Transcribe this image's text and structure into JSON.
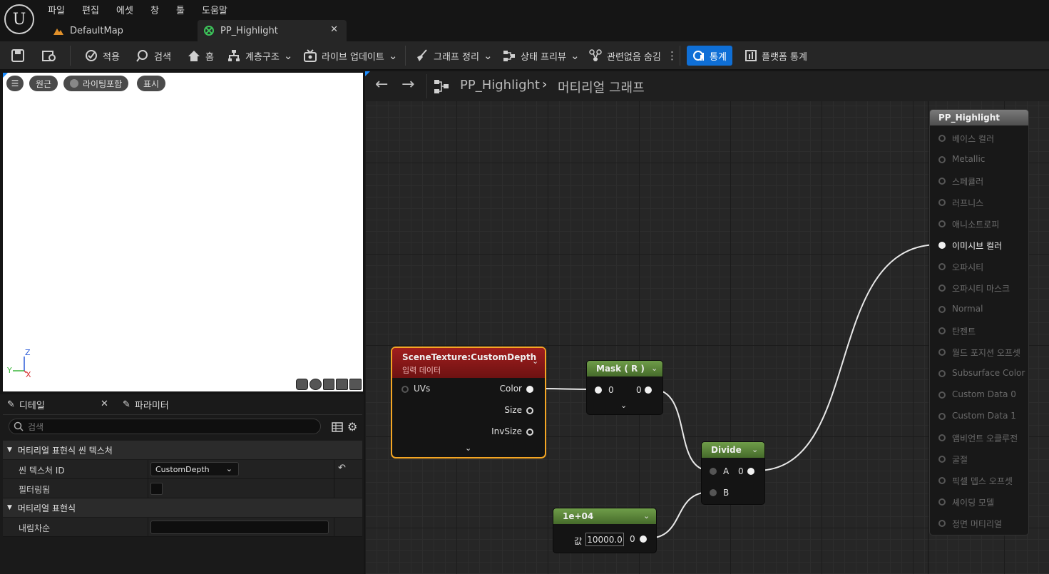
{
  "menu": [
    "파일",
    "편집",
    "에셋",
    "창",
    "툴",
    "도움말"
  ],
  "tabs": [
    {
      "label": "DefaultMap",
      "active": false
    },
    {
      "label": "PP_Highlight",
      "active": true
    }
  ],
  "toolbar": {
    "apply": "적용",
    "search": "검색",
    "home": "홈",
    "hierarchy": "계층구조",
    "live_update": "라이브 업데이트",
    "graph_cleanup": "그래프 정리",
    "state_preview": "상태 프리뷰",
    "hide_unrelated": "관련없음 숨김",
    "stats": "통계",
    "platform_stats": "플랫폼 통계"
  },
  "viewport": {
    "perspective": "원근",
    "lit": "라이팅포함",
    "show": "표시",
    "axis_z": "Z",
    "axis_y": "Y",
    "axis_x": "X"
  },
  "details": {
    "tab_details": "디테일",
    "tab_params": "파라미터",
    "search_placeholder": "검색",
    "cat1": "머티리얼 표현식 씬 텍스처",
    "scene_texture_id_label": "씬 텍스처 ID",
    "scene_texture_id_value": "CustomDepth",
    "filtered_label": "필터링됨",
    "cat2": "머티리얼 표현식",
    "desc_label": "내림차순",
    "desc_value": ""
  },
  "graph": {
    "breadcrumb_asset": "PP_Highlight",
    "breadcrumb_graph": "머티리얼 그래프",
    "scene_node": {
      "title": "SceneTexture:CustomDepth",
      "subtitle": "입력 데이터",
      "input": "UVs",
      "outputs": [
        "Color",
        "Size",
        "InvSize"
      ]
    },
    "mask_node": {
      "title": "Mask ( R )",
      "in": "0",
      "out": "0"
    },
    "divide_node": {
      "title": "Divide",
      "a": "A",
      "b": "B",
      "out": "0"
    },
    "const_node": {
      "title": "1e+04",
      "value_label": "값",
      "value": "10000.0",
      "out": "0"
    },
    "result_node": {
      "title": "PP_Highlight",
      "pins": [
        "베이스 컬러",
        "Metallic",
        "스페큘러",
        "러프니스",
        "애니소트로피",
        "이미시브 컬러",
        "오파시티",
        "오파시티 마스크",
        "Normal",
        "탄젠트",
        "월드 포지션 오프셋",
        "Subsurface Color",
        "Custom Data 0",
        "Custom Data 1",
        "앰비언트 오클루전",
        "굴절",
        "픽셀 뎁스 오프셋",
        "셰이딩 모델",
        "정면 머티리얼"
      ],
      "active_pin_index": 5
    }
  },
  "colors": {
    "accent_blue": "#0f6fd6",
    "scene_header": "#8e1a1a",
    "selected_outline": "#f5a623",
    "green_header": "#5d8a3a"
  }
}
